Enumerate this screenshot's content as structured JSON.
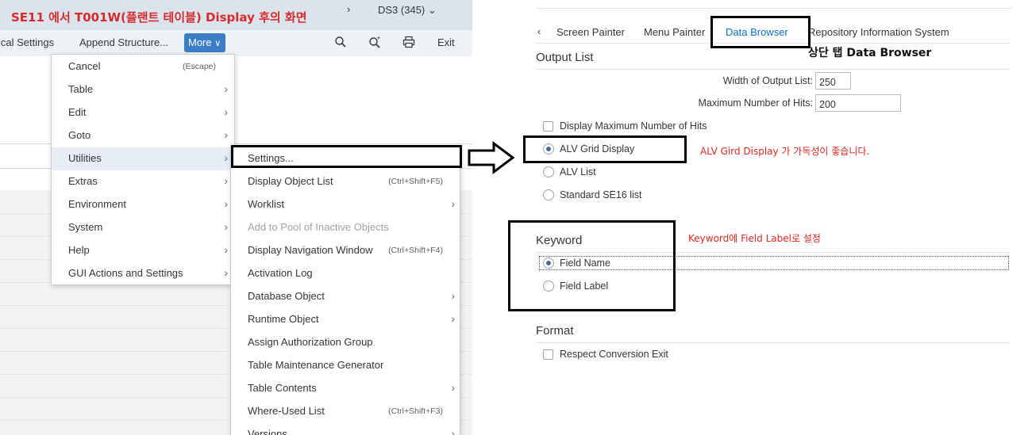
{
  "left": {
    "caption": "SE11 에서 T001W(플랜트 테이블) Display 후의 화면",
    "system_id": "DS3 (345)",
    "toolbar": {
      "technical_settings": "ical Settings",
      "append_structure": "Append Structure...",
      "more": "More",
      "exit": "Exit"
    },
    "main_menu": [
      {
        "label": "Cancel",
        "shortcut": "(Escape)",
        "has_sub": false
      },
      {
        "label": "Table",
        "shortcut": "",
        "has_sub": true
      },
      {
        "label": "Edit",
        "shortcut": "",
        "has_sub": true
      },
      {
        "label": "Goto",
        "shortcut": "",
        "has_sub": true
      },
      {
        "label": "Utilities",
        "shortcut": "",
        "has_sub": true,
        "highlight": true
      },
      {
        "label": "Extras",
        "shortcut": "",
        "has_sub": true
      },
      {
        "label": "Environment",
        "shortcut": "",
        "has_sub": true
      },
      {
        "label": "System",
        "shortcut": "",
        "has_sub": true
      },
      {
        "label": "Help",
        "shortcut": "",
        "has_sub": true
      },
      {
        "label": "GUI Actions and Settings",
        "shortcut": "",
        "has_sub": true
      }
    ],
    "sub_menu": [
      {
        "label": "Settings...",
        "shortcut": "",
        "has_sub": false
      },
      {
        "label": "Display Object List",
        "shortcut": "(Ctrl+Shift+F5)",
        "has_sub": false
      },
      {
        "label": "Worklist",
        "shortcut": "",
        "has_sub": true
      },
      {
        "label": "Add to Pool of Inactive Objects",
        "shortcut": "",
        "has_sub": false,
        "disabled": true
      },
      {
        "label": "Display Navigation Window",
        "shortcut": "(Ctrl+Shift+F4)",
        "has_sub": false
      },
      {
        "label": "Activation Log",
        "shortcut": "",
        "has_sub": false
      },
      {
        "label": "Database Object",
        "shortcut": "",
        "has_sub": true
      },
      {
        "label": "Runtime Object",
        "shortcut": "",
        "has_sub": true
      },
      {
        "label": "Assign Authorization Group",
        "shortcut": "",
        "has_sub": false
      },
      {
        "label": "Table Maintenance Generator",
        "shortcut": "",
        "has_sub": false
      },
      {
        "label": "Table Contents",
        "shortcut": "",
        "has_sub": true
      },
      {
        "label": "Where-Used List",
        "shortcut": "(Ctrl+Shift+F3)",
        "has_sub": false
      },
      {
        "label": "Versions",
        "shortcut": "",
        "has_sub": true
      }
    ]
  },
  "right": {
    "tabs": [
      "Screen Painter",
      "Menu Painter",
      "Data Browser",
      "Repository Information System"
    ],
    "active_tab": "Data Browser",
    "output_list": {
      "title": "Output List",
      "width_label": "Width of Output List:",
      "width_value": "250",
      "max_hits_label": "Maximum Number of Hits:",
      "max_hits_value": "200",
      "display_max_hits": "Display Maximum Number of Hits",
      "display_max_hits_checked": false,
      "options": [
        {
          "label": "ALV Grid Display",
          "selected": true
        },
        {
          "label": "ALV List",
          "selected": false
        },
        {
          "label": "Standard SE16 list",
          "selected": false
        }
      ]
    },
    "keyword": {
      "title": "Keyword",
      "options": [
        {
          "label": "Field Name",
          "selected": true
        },
        {
          "label": "Field Label",
          "selected": false
        }
      ]
    },
    "format": {
      "title": "Format",
      "respect_conversion_exit": "Respect Conversion Exit",
      "respect_conversion_exit_checked": false
    }
  },
  "annotations": {
    "top_tab_note": "상단 탭 Data Browser",
    "alv_note": "ALV Gird Display 가 가독성이 좋습니다.",
    "keyword_note": "Keyword에 Field Label로 설정"
  },
  "colors": {
    "accent": "#0a6ed1",
    "more_button": "#3b7ec7",
    "annotation_red": "#e0261f",
    "caption_red": "#d62b2b"
  }
}
